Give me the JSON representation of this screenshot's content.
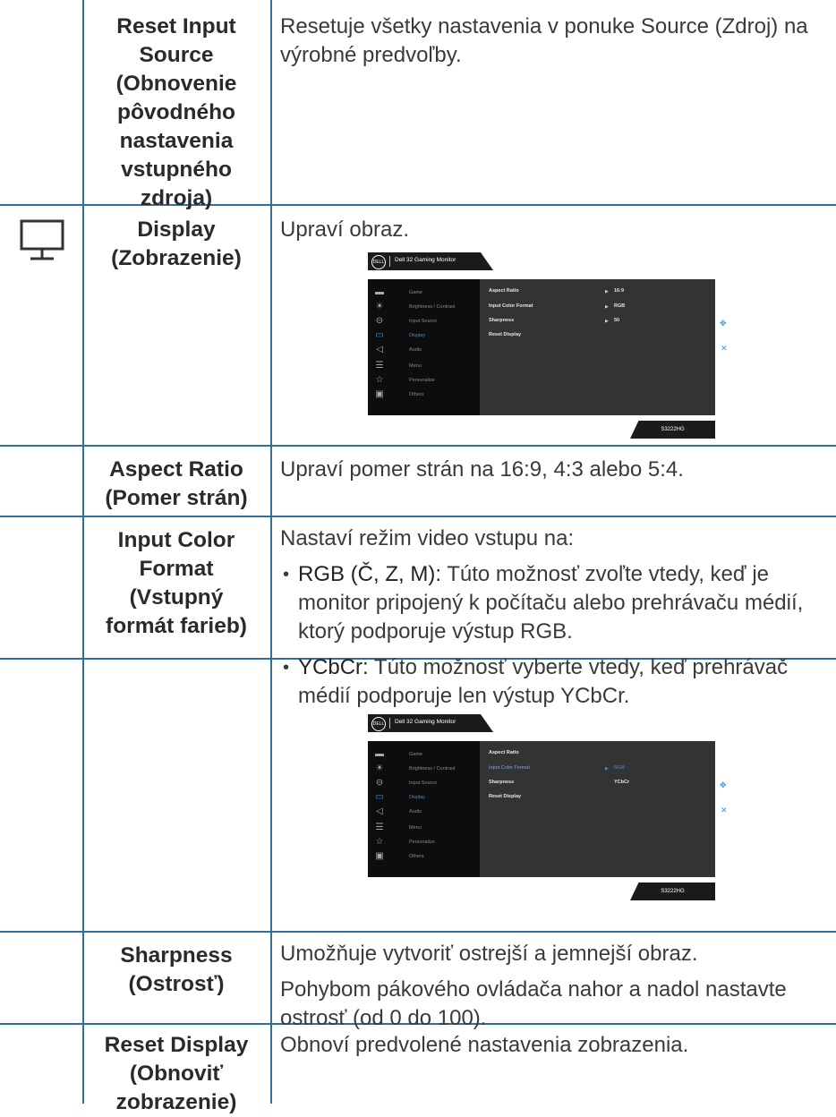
{
  "rows": [
    {
      "name": "Reset Input Source (Obnovenie pôvodného nastavenia vstupného zdroja)",
      "desc": "Resetuje všetky nastavenia v ponuke Source (Zdroj) na výrobné predvoľby."
    },
    {
      "name": "Display (Zobrazenie)",
      "desc": "Upraví obraz.",
      "icon": "monitor-icon"
    },
    {
      "name": "Aspect Ratio (Pomer strán)",
      "desc": "Upraví pomer strán na 16:9, 4:3 alebo 5:4."
    },
    {
      "name": "Input Color Format (Vstupný formát farieb)",
      "intro": "Nastaví režim video vstupu na:",
      "bullets": [
        {
          "term": "RGB (Č, Z, M):",
          "text": "Túto možnosť zvoľte vtedy, keď je monitor pripojený k počítaču alebo prehrávaču médií, ktorý podporuje výstup RGB."
        },
        {
          "term": "YCbCr:",
          "text": "Túto možnosť vyberte vtedy, keď prehrávač médií podporuje len výstup YCbCr."
        }
      ]
    },
    {
      "name": "Sharpness (Ostrosť)",
      "desc": "Umožňuje vytvoriť ostrejší a jemnejší obraz.",
      "desc2": "Pohybom pákového ovládača nahor a nadol nastavte ostrosť (od 0 do 100)."
    },
    {
      "name": "Reset Display (Obnoviť zobrazenie)",
      "desc": "Obnoví predvolené nastavenia zobrazenia."
    }
  ],
  "name_lines": {
    "r0": [
      "Reset Input",
      "Source",
      "(Obnovenie",
      "pôvodného",
      "nastavenia",
      "vstupného",
      "zdroja)"
    ],
    "r1": [
      "Display",
      "(Zobrazenie)"
    ],
    "r2": [
      "Aspect Ratio",
      "(Pomer strán)"
    ],
    "r3": [
      "Input Color",
      "Format",
      "(Vstupný",
      "formát farieb)"
    ],
    "r4": [
      "Sharpness",
      "(Ostrosť)"
    ],
    "r5": [
      "Reset Display",
      "(Obnoviť",
      "zobrazenie)"
    ]
  },
  "osd": {
    "logo": "DELL",
    "title": "Dell 32 Gaming Monitor",
    "model": "S3222HG",
    "menu": [
      {
        "icon": "game-icon",
        "glyph": "▬",
        "label": "Game"
      },
      {
        "icon": "brightness-icon",
        "glyph": "☀",
        "label": "Brightness / Contrast"
      },
      {
        "icon": "input-source-icon",
        "glyph": "⊝",
        "label": "Input Source"
      },
      {
        "icon": "display-icon",
        "glyph": "▭",
        "label": "Display"
      },
      {
        "icon": "audio-icon",
        "glyph": "◁",
        "label": "Audio"
      },
      {
        "icon": "menu-icon",
        "glyph": "☰",
        "label": "Menu"
      },
      {
        "icon": "star-icon",
        "glyph": "☆",
        "label": "Personalize"
      },
      {
        "icon": "others-icon",
        "glyph": "▣",
        "label": "Others"
      }
    ],
    "sub1": [
      {
        "label": "Aspect Ratio",
        "value": "16:9"
      },
      {
        "label": "Input Color Format",
        "value": "RGB"
      },
      {
        "label": "Sharpness",
        "value": "50"
      },
      {
        "label": "Reset Display",
        "value": ""
      }
    ],
    "sub2": [
      {
        "label": "Aspect Ratio",
        "value": ""
      },
      {
        "label": "Input Color Format",
        "value": "RGB"
      },
      {
        "label": "Sharpness",
        "value": "YCbCr"
      },
      {
        "label": "Reset Display",
        "value": ""
      }
    ],
    "nav_move": "✥",
    "nav_close": "✕"
  }
}
